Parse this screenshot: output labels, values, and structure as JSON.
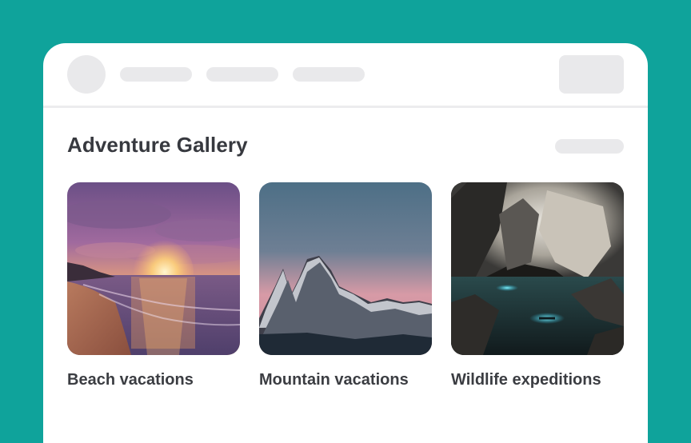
{
  "page": {
    "background_color": "#0fa39b",
    "title": "Adventure Gallery"
  },
  "nav": {
    "placeholder_count": 3
  },
  "gallery": {
    "items": [
      {
        "label": "Beach vacations",
        "image": "beach-sunset-photo"
      },
      {
        "label": "Mountain vacations",
        "image": "mountain-peaks-photo"
      },
      {
        "label": "Wildlife expeditions",
        "image": "cave-kayak-photo"
      }
    ]
  }
}
